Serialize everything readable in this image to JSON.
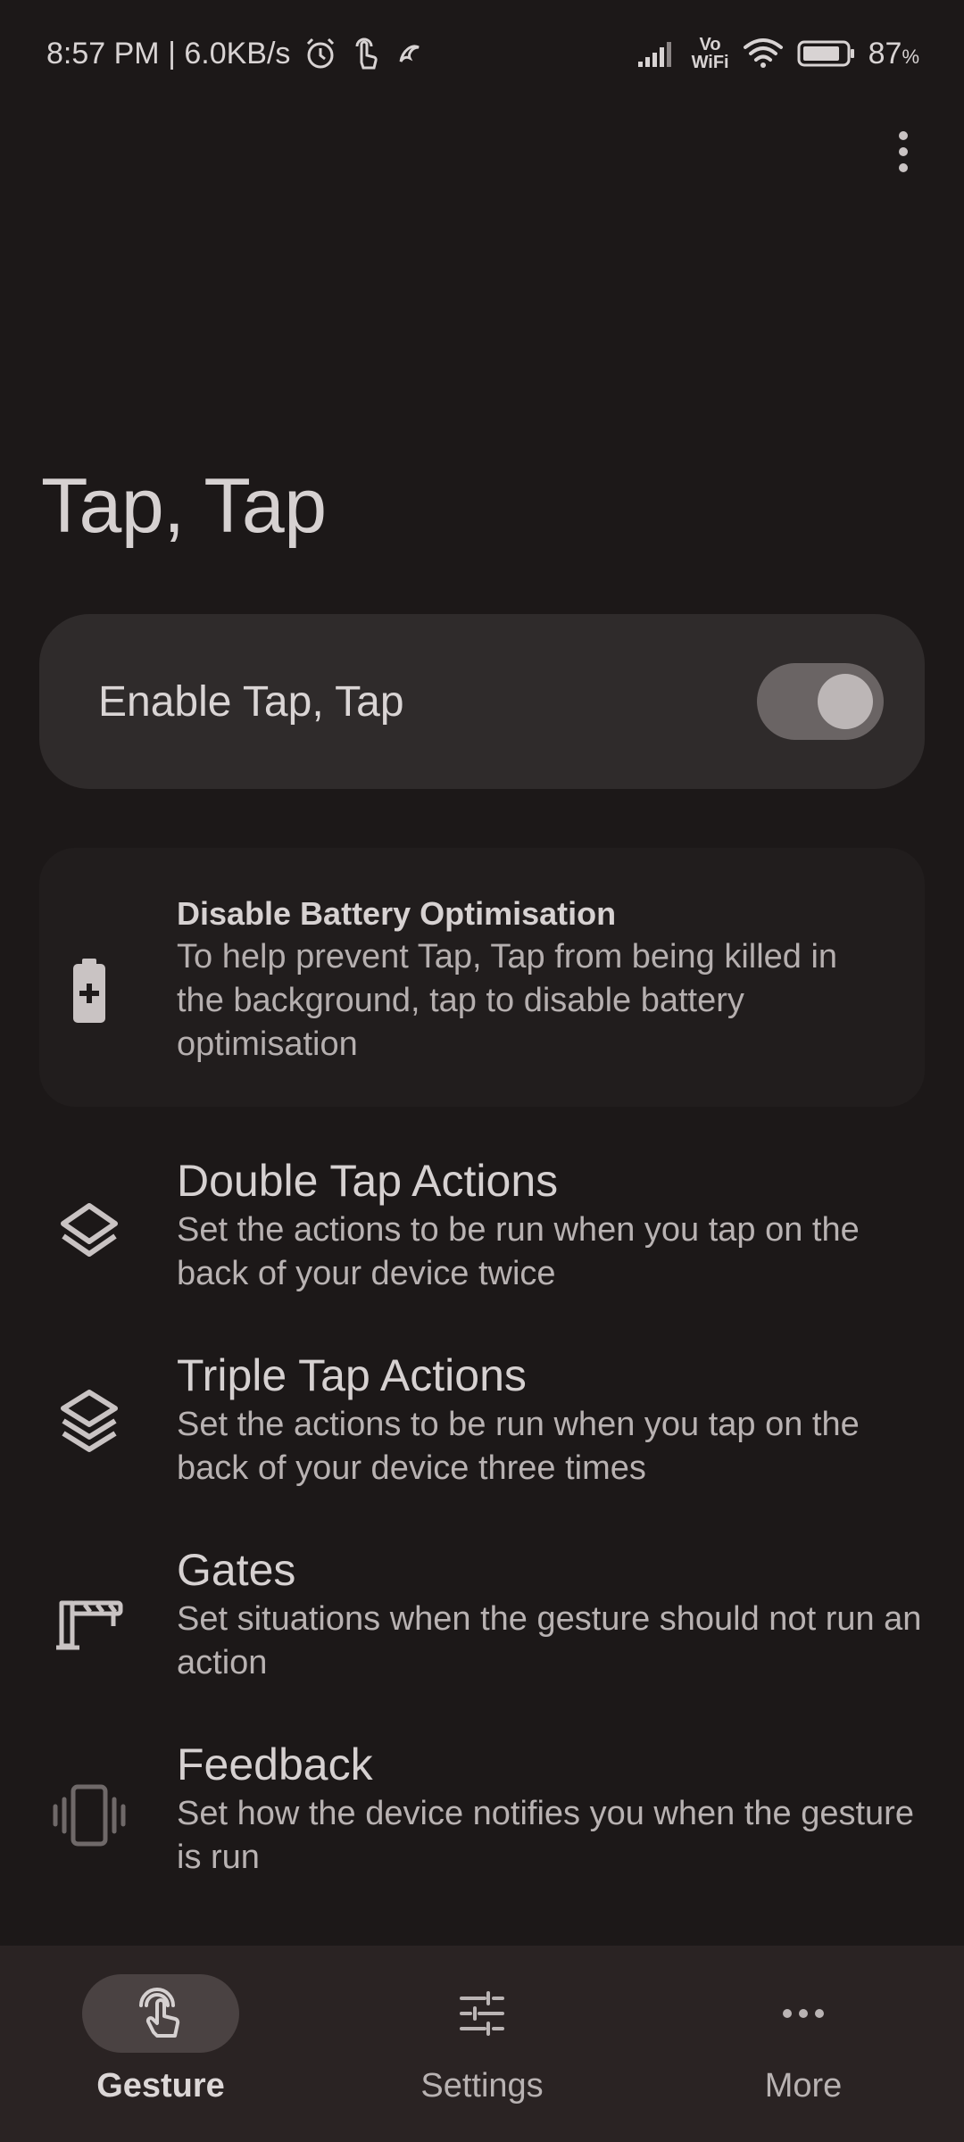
{
  "status_bar": {
    "time_speed": "8:57 PM | 6.0KB/s",
    "battery_percent": "87",
    "battery_suffix": "%",
    "vo_wifi_top": "Vo",
    "vo_wifi_bottom": "WiFi",
    "battery_level": 0.87,
    "left_icons": [
      "alarm-icon",
      "touch-icon",
      "app-notification-icon"
    ],
    "right_icons": [
      "signal-icon",
      "vowifi-icon",
      "wifi-icon",
      "battery-icon"
    ]
  },
  "page": {
    "title": "Tap, Tap"
  },
  "enable": {
    "label": "Enable Tap, Tap",
    "toggle_on": true
  },
  "battery_card": {
    "title": "Disable Battery Optimisation",
    "desc": "To help prevent Tap, Tap from being killed in the background, tap to disable battery optimisation",
    "icon": "battery-plus-icon"
  },
  "items": [
    {
      "title": "Double Tap Actions",
      "desc": "Set the actions to be run when you tap on the back of your device twice",
      "icon": "layers-double-icon"
    },
    {
      "title": "Triple Tap Actions",
      "desc": "Set the actions to be run when you tap on the back of your device three times",
      "icon": "layers-triple-icon"
    },
    {
      "title": "Gates",
      "desc": "Set situations when the gesture should not run an action",
      "icon": "gate-icon"
    },
    {
      "title": "Feedback",
      "desc": "Set how the device notifies you when the gesture is run",
      "icon": "vibration-icon"
    }
  ],
  "nav": [
    {
      "label": "Gesture",
      "icon": "touch-gesture-icon",
      "active": true
    },
    {
      "label": "Settings",
      "icon": "sliders-icon",
      "active": false
    },
    {
      "label": "More",
      "icon": "more-horizontal-icon",
      "active": false
    }
  ],
  "colors": {
    "background": "#1c1818",
    "card": "#2f2b2b",
    "nav_background": "#2a2323",
    "nav_active_pill": "#4a4242"
  }
}
